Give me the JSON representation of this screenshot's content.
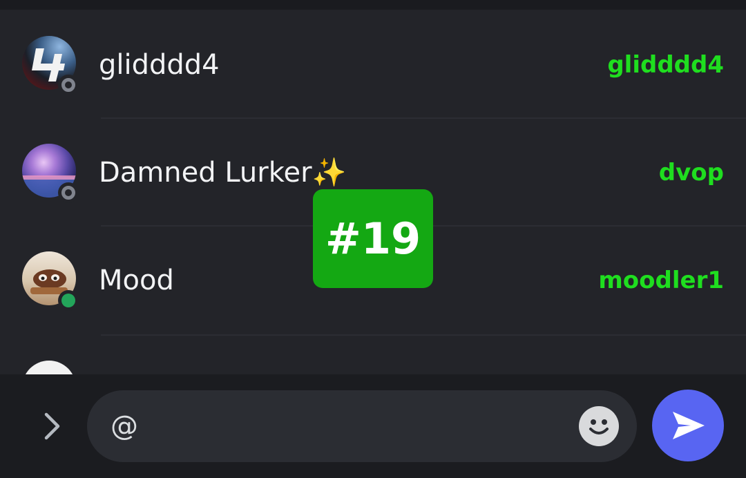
{
  "members": [
    {
      "display_name": "glidddd4",
      "username": "glidddd4",
      "status": "offline"
    },
    {
      "display_name": "Damned Lurker",
      "emoji": "✨",
      "username": "dvop",
      "status": "offline"
    },
    {
      "display_name": "Mood",
      "username": "moodler1",
      "status": "online"
    }
  ],
  "badge": {
    "label": "#19"
  },
  "composer": {
    "value": "@"
  },
  "colors": {
    "accent_username": "#1fde1f",
    "online": "#23a55a",
    "send": "#5865f2",
    "badge": "#14a813"
  }
}
